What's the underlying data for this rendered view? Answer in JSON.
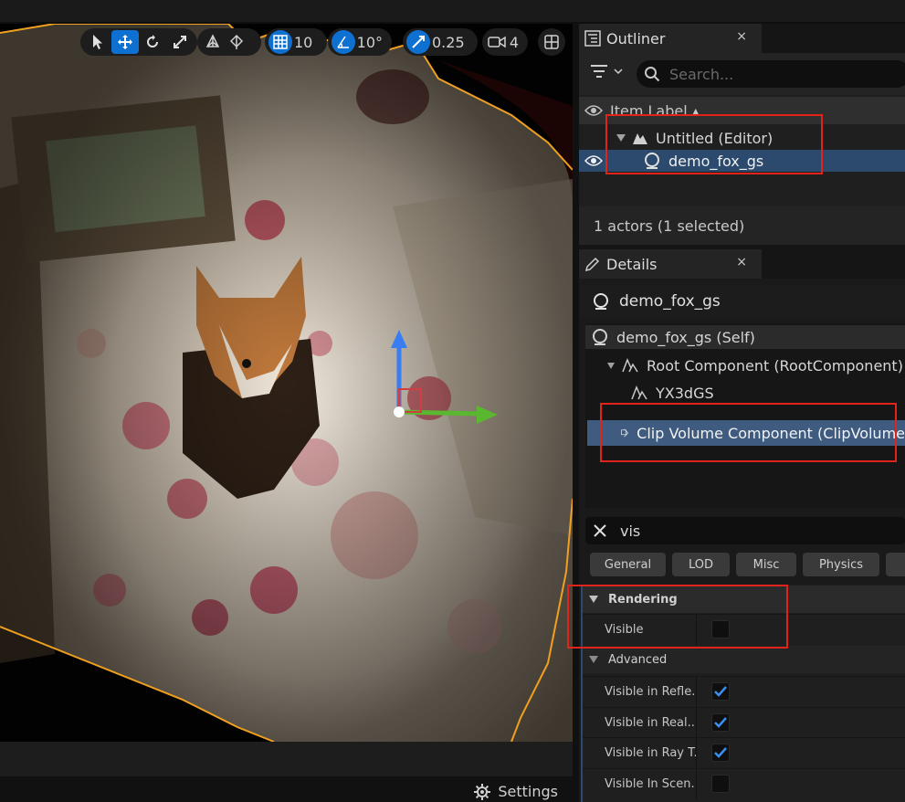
{
  "toolbar": {
    "grid_value": "10",
    "rotation_value": "10°",
    "scale_value": "0.25",
    "camera_value": "4",
    "icons": [
      "select-icon",
      "translate-icon",
      "rotate-icon",
      "scale-icon",
      "world-local-icon",
      "surface-snap-icon",
      "grid-snap-icon",
      "rotation-snap-icon",
      "scale-snap-icon",
      "camera-speed-icon",
      "viewport-layout-icon"
    ]
  },
  "viewport": {
    "settings_label": "Settings"
  },
  "outliner": {
    "title": "Outliner",
    "close": "×",
    "search_placeholder": "Search...",
    "column_header": "Item Label ▴",
    "items": [
      {
        "label": "Untitled (Editor)"
      },
      {
        "label": "demo_fox_gs"
      }
    ],
    "status": "1 actors (1 selected)"
  },
  "details": {
    "title": "Details",
    "close": "×",
    "actor_name": "demo_fox_gs",
    "components": [
      {
        "label": "demo_fox_gs (Self)"
      },
      {
        "label": "Root Component (RootComponent)"
      },
      {
        "label": "YX3dGS"
      },
      {
        "label": "Clip Volume Component (ClipVolume"
      }
    ],
    "search_value": "vis",
    "categories": [
      "General",
      "LOD",
      "Misc",
      "Physics"
    ],
    "sections": {
      "rendering": "Rendering",
      "advanced": "Advanced"
    },
    "properties": [
      {
        "label": "Visible",
        "checked": false
      },
      {
        "label": "Visible in Refle...",
        "checked": true
      },
      {
        "label": "Visible in Real...",
        "checked": true
      },
      {
        "label": "Visible in Ray T...",
        "checked": true
      },
      {
        "label": "Visible In Scen...",
        "checked": false
      }
    ]
  },
  "colors": {
    "accent_blue": "#0e70d1",
    "selection_orange": "#f0a020",
    "highlight_red": "#e0241c"
  }
}
